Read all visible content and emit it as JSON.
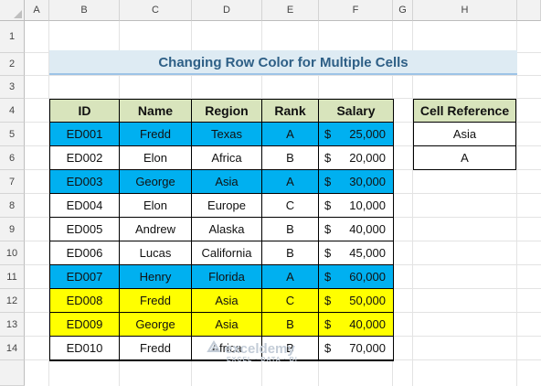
{
  "columns": [
    "A",
    "B",
    "C",
    "D",
    "E",
    "F",
    "G",
    "H"
  ],
  "rows": [
    "1",
    "2",
    "3",
    "4",
    "5",
    "6",
    "7",
    "8",
    "9",
    "10",
    "11",
    "12",
    "13",
    "14"
  ],
  "title": "Changing Row Color for Multiple Cells",
  "table": {
    "headers": [
      "ID",
      "Name",
      "Region",
      "Rank",
      "Salary"
    ],
    "rows": [
      {
        "id": "ED001",
        "name": "Fredd",
        "region": "Texas",
        "rank": "A",
        "cur": "$",
        "salary": "25,000",
        "highlight": "blue"
      },
      {
        "id": "ED002",
        "name": "Elon",
        "region": "Africa",
        "rank": "B",
        "cur": "$",
        "salary": "20,000",
        "highlight": "none"
      },
      {
        "id": "ED003",
        "name": "George",
        "region": "Asia",
        "rank": "A",
        "cur": "$",
        "salary": "30,000",
        "highlight": "blue"
      },
      {
        "id": "ED004",
        "name": "Elon",
        "region": "Europe",
        "rank": "C",
        "cur": "$",
        "salary": "10,000",
        "highlight": "none"
      },
      {
        "id": "ED005",
        "name": "Andrew",
        "region": "Alaska",
        "rank": "B",
        "cur": "$",
        "salary": "40,000",
        "highlight": "none"
      },
      {
        "id": "ED006",
        "name": "Lucas",
        "region": "California",
        "rank": "B",
        "cur": "$",
        "salary": "45,000",
        "highlight": "none"
      },
      {
        "id": "ED007",
        "name": "Henry",
        "region": "Florida",
        "rank": "A",
        "cur": "$",
        "salary": "60,000",
        "highlight": "blue"
      },
      {
        "id": "ED008",
        "name": "Fredd",
        "region": "Asia",
        "rank": "C",
        "cur": "$",
        "salary": "50,000",
        "highlight": "yellow"
      },
      {
        "id": "ED009",
        "name": "George",
        "region": "Asia",
        "rank": "B",
        "cur": "$",
        "salary": "40,000",
        "highlight": "yellow"
      },
      {
        "id": "ED010",
        "name": "Fredd",
        "region": "Africa",
        "rank": "B",
        "cur": "$",
        "salary": "70,000",
        "highlight": "none"
      }
    ]
  },
  "reference": {
    "header": "Cell Reference",
    "values": [
      "Asia",
      "A"
    ]
  },
  "colors": {
    "blue": "#00b0f0",
    "yellow": "#ffff00",
    "none": "#ffffff",
    "header_green": "#d8e4bc",
    "title_bg": "#deebf3",
    "title_text": "#2e5f86"
  },
  "watermark": {
    "brand": "exceldemy",
    "tagline": "EXCEL · DATA · BI"
  }
}
